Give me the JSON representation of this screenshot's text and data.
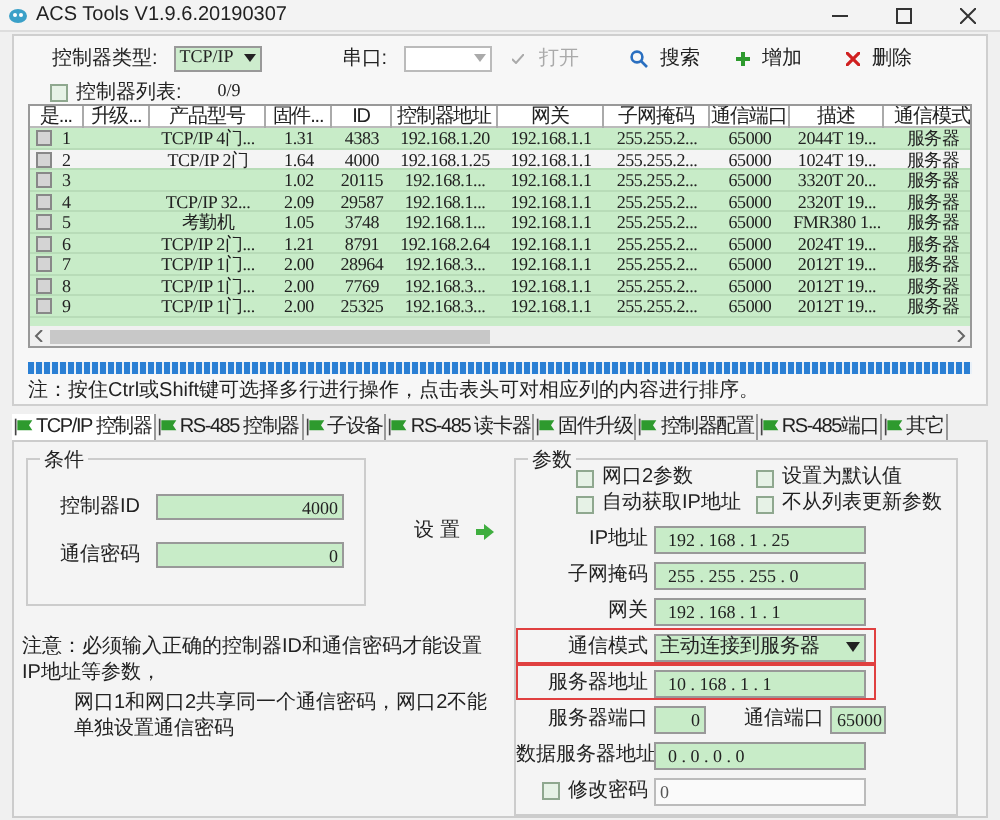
{
  "window": {
    "title": "ACS Tools V1.9.6.20190307"
  },
  "toolbar": {
    "type_label": "控制器类型:",
    "type_value": "TCP/IP",
    "port_label": "串口:",
    "open_label": "打开",
    "open_disabled": true,
    "search": "搜索",
    "add": "增加",
    "delete": "删除"
  },
  "list_header": {
    "label": "控制器列表:",
    "checked": false,
    "count": "0/9"
  },
  "table": {
    "columns": [
      "是...",
      "升级...",
      "产品型号",
      "固件...",
      "ID",
      "控制器地址",
      "网关",
      "子网掩码",
      "通信端口",
      "描述",
      "通信模式"
    ],
    "rows": [
      {
        "selected": false,
        "checked": false,
        "cells": [
          "1",
          "",
          "TCP/IP 4门...",
          "1.31",
          "4383",
          "192.168.1.20",
          "192.168.1.1",
          "255.255.2...",
          "65000",
          "2044T 19...",
          "服务器"
        ]
      },
      {
        "selected": true,
        "checked": false,
        "cells": [
          "2",
          "",
          "TCP/IP 2门",
          "1.64",
          "4000",
          "192.168.1.25",
          "192.168.1.1",
          "255.255.2...",
          "65000",
          "1024T 19...",
          "服务器"
        ]
      },
      {
        "selected": false,
        "checked": false,
        "cells": [
          "3",
          "",
          "",
          "1.02",
          "20115",
          "192.168.1...",
          "192.168.1.1",
          "255.255.2...",
          "65000",
          "3320T 20...",
          "服务器"
        ]
      },
      {
        "selected": false,
        "checked": false,
        "cells": [
          "4",
          "",
          "TCP/IP 32...",
          "2.09",
          "29587",
          "192.168.1...",
          "192.168.1.1",
          "255.255.2...",
          "65000",
          "2320T 19...",
          "服务器"
        ]
      },
      {
        "selected": false,
        "checked": false,
        "cells": [
          "5",
          "",
          "考勤机",
          "1.05",
          "3748",
          "192.168.1...",
          "192.168.1.1",
          "255.255.2...",
          "65000",
          "FMR380 1...",
          "服务器"
        ]
      },
      {
        "selected": false,
        "checked": false,
        "cells": [
          "6",
          "",
          "TCP/IP 2门...",
          "1.21",
          "8791",
          "192.168.2.64",
          "192.168.1.1",
          "255.255.2...",
          "65000",
          "2024T 19...",
          "服务器"
        ]
      },
      {
        "selected": false,
        "checked": false,
        "cells": [
          "7",
          "",
          "TCP/IP 1门...",
          "2.00",
          "28964",
          "192.168.3...",
          "192.168.1.1",
          "255.255.2...",
          "65000",
          "2012T 19...",
          "服务器"
        ]
      },
      {
        "selected": false,
        "checked": false,
        "cells": [
          "8",
          "",
          "TCP/IP 1门...",
          "2.00",
          "7769",
          "192.168.3...",
          "192.168.1.1",
          "255.255.2...",
          "65000",
          "2012T 19...",
          "服务器"
        ]
      },
      {
        "selected": false,
        "checked": false,
        "cells": [
          "9",
          "",
          "TCP/IP 1门...",
          "2.00",
          "25325",
          "192.168.3...",
          "192.168.1.1",
          "255.255.2...",
          "65000",
          "2012T 19...",
          "服务器"
        ]
      }
    ]
  },
  "progress": {
    "level": 1
  },
  "note": "注：按住Ctrl或Shift键可选择多行进行操作，点击表头可对相应列的内容进行排序。",
  "tabs": [
    {
      "label": "TCP/IP 控制器",
      "selected": true
    },
    {
      "label": "RS-485 控制器",
      "selected": false
    },
    {
      "label": "子设备",
      "selected": false
    },
    {
      "label": "RS-485 读卡器",
      "selected": false
    },
    {
      "label": "固件升级",
      "selected": false
    },
    {
      "label": "控制器配置",
      "selected": false
    },
    {
      "label": "RS-485端口",
      "selected": false
    },
    {
      "label": "其它",
      "selected": false
    }
  ],
  "conditions": {
    "title": "条件",
    "fields": [
      {
        "label": "控制器ID",
        "value": "4000"
      },
      {
        "label": "通信密码",
        "value": "0"
      }
    ],
    "set_button": "设 置",
    "notes": [
      "注意：必须输入正确的控制器ID和通信密码才能设置 IP地址等参数，",
      "网口1和网口2共享同一个通信密码，网口2不能单独设置通信密码"
    ]
  },
  "parameters": {
    "title": "参数",
    "options": [
      {
        "label": "网口2参数",
        "checked": false
      },
      {
        "label": "设置为默认值",
        "checked": false
      },
      {
        "label": "自动获取IP地址",
        "checked": false
      },
      {
        "label": "不从列表更新参数",
        "checked": false
      }
    ],
    "fields": [
      {
        "kind": "ip",
        "label": "IP地址",
        "value": "192 . 168 . 1 . 25",
        "highlighted": false
      },
      {
        "kind": "ip",
        "label": "子网掩码",
        "value": "255 . 255 . 255 . 0",
        "highlighted": false
      },
      {
        "kind": "ip",
        "label": "网关",
        "value": "192 . 168 . 1 . 1",
        "highlighted": false
      },
      {
        "kind": "select",
        "label": "通信模式",
        "value": "主动连接到服务器",
        "highlighted": true
      },
      {
        "kind": "ip",
        "label": "服务器地址",
        "value": "10 . 168 . 1 . 1",
        "highlighted": true
      }
    ],
    "server_port": {
      "label": "服务器端口",
      "value": "0"
    },
    "comm_port": {
      "label": "通信端口",
      "value": "65000"
    },
    "data_server": {
      "label": "数据服务器地址",
      "value": "0 . 0 . 0 . 0"
    },
    "change_password": {
      "label": "修改密码",
      "checked": false,
      "value": "0"
    }
  }
}
